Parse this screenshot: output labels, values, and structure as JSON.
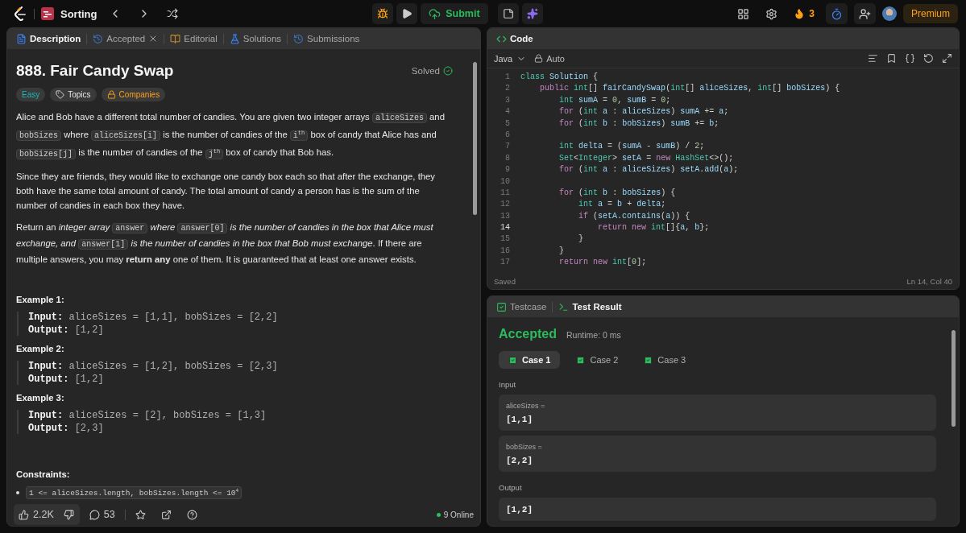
{
  "top_bar": {
    "problem_list": "Sorting",
    "submit": "Submit",
    "streak": "3",
    "premium": "Premium"
  },
  "description": {
    "tabs": [
      {
        "label": "Description",
        "selected": true,
        "closable": false,
        "kind": "description"
      },
      {
        "label": "Accepted",
        "selected": false,
        "closable": true,
        "kind": "history"
      },
      {
        "label": "Editorial",
        "selected": false,
        "closable": false,
        "kind": "book"
      },
      {
        "label": "Solutions",
        "selected": false,
        "closable": false,
        "kind": "flask"
      },
      {
        "label": "Submissions",
        "selected": false,
        "closable": false,
        "kind": "history"
      }
    ],
    "title": "888. Fair Candy Swap",
    "status": "Solved",
    "tags": [
      {
        "label": "Easy",
        "kind": "difficulty"
      },
      {
        "label": "Topics",
        "kind": "topics"
      },
      {
        "label": "Companies",
        "kind": "companies"
      }
    ],
    "paragraphs": [
      [
        {
          "kind": "text",
          "text": "Alice and Bob have a different total number of candies. You are given two integer arrays "
        },
        {
          "kind": "code",
          "text": "aliceSizes"
        },
        {
          "kind": "text",
          "text": " and "
        },
        {
          "kind": "code",
          "text": "bobSizes"
        },
        {
          "kind": "text",
          "text": " where "
        },
        {
          "kind": "code",
          "text": "aliceSizes[i]"
        },
        {
          "kind": "text",
          "text": " is the number of candies of the "
        },
        {
          "kind": "code",
          "text": "i$^{th}$"
        },
        {
          "kind": "text",
          "text": " box of candy that Alice has and "
        },
        {
          "kind": "code",
          "text": "bobSizes[j]"
        },
        {
          "kind": "text",
          "text": " is the number of candies of the "
        },
        {
          "kind": "code",
          "text": "j$^{th}$"
        },
        {
          "kind": "text",
          "text": " box of candy that Bob has."
        }
      ],
      [
        {
          "kind": "text",
          "text": "Since they are friends, they would like to exchange one candy box each so that after the exchange, they both have the same total amount of candy. The total amount of candy a person has is the sum of the number of candies in each box they have."
        }
      ],
      [
        {
          "kind": "text",
          "text": "Return an *integer array* "
        },
        {
          "kind": "code",
          "text": "answer"
        },
        {
          "kind": "text",
          "text": " *where* "
        },
        {
          "kind": "code",
          "text": "answer[0]"
        },
        {
          "kind": "text",
          "text": " *is the number of candies in the box that Alice must exchange, and* "
        },
        {
          "kind": "code",
          "text": "answer[1]"
        },
        {
          "kind": "text",
          "text": " *is the number of candies in the box that Bob must exchange*. If there are multiple answers, you may **return any** one of them. It is guaranteed that at least one answer exists."
        }
      ]
    ],
    "examples": [
      {
        "title": "Example 1:",
        "input_label": "Input:",
        "input": "aliceSizes = [1,1], bobSizes = [2,2]",
        "output_label": "Output:",
        "output": "[1,2]"
      },
      {
        "title": "Example 2:",
        "input_label": "Input:",
        "input": "aliceSizes = [1,2], bobSizes = [2,3]",
        "output_label": "Output:",
        "output": "[1,2]"
      },
      {
        "title": "Example 3:",
        "input_label": "Input:",
        "input": "aliceSizes = [2], bobSizes = [1,3]",
        "output_label": "Output:",
        "output": "[2,3]"
      }
    ],
    "constraints_title": "Constraints:",
    "constraints": [
      "1 <= aliceSizes.length, bobSizes.length <= 10$^{4}$"
    ],
    "footer": {
      "likes": "2.2K",
      "comments": "53",
      "online": "9 Online"
    }
  },
  "code": {
    "title": "Code",
    "language": "Java",
    "mode": "Auto",
    "lines": [
      {
        "number": "1",
        "code": "class Solution {",
        "current": false
      },
      {
        "number": "2",
        "code": "    public int[] fairCandySwap(int[] aliceSizes, int[] bobSizes) {",
        "current": false
      },
      {
        "number": "3",
        "code": "        int sumA = 0, sumB = 0;",
        "current": false
      },
      {
        "number": "4",
        "code": "        for (int a : aliceSizes) sumA += a;",
        "current": false
      },
      {
        "number": "5",
        "code": "        for (int b : bobSizes) sumB += b;",
        "current": false
      },
      {
        "number": "6",
        "current": false
      },
      {
        "number": "7",
        "code": "        int delta = (sumA - sumB) / 2;",
        "current": false
      },
      {
        "number": "8",
        "code": "        Set<Integer> setA = new HashSet<>();",
        "current": false
      },
      {
        "number": "9",
        "code": "        for (int a : aliceSizes) setA.add(a);",
        "current": false
      },
      {
        "number": "10",
        "current": false
      },
      {
        "number": "11",
        "code": "        for (int b : bobSizes) {",
        "current": false
      },
      {
        "number": "12",
        "code": "            int a = b + delta;",
        "current": false
      },
      {
        "number": "13",
        "code": "            if (setA.contains(a)) {",
        "current": false
      },
      {
        "number": "14",
        "code": "                return new int[]{a, b};",
        "current": true
      },
      {
        "number": "15",
        "code": "            }",
        "current": false
      },
      {
        "number": "16",
        "code": "        }",
        "current": false
      },
      {
        "number": "17",
        "code": "        return new int[0];",
        "current": false
      }
    ],
    "status": "Saved",
    "cursor": "Ln 14, Col 40"
  },
  "result": {
    "tabs": [
      {
        "label": "Testcase",
        "selected": false,
        "kind": "testcase"
      },
      {
        "label": "Test Result",
        "selected": true,
        "kind": "terminal"
      }
    ],
    "verdict": "Accepted",
    "runtime": "Runtime: 0 ms",
    "cases": [
      {
        "label": "Case 1",
        "selected": true,
        "passed": true
      },
      {
        "label": "Case 2",
        "selected": false,
        "passed": true
      },
      {
        "label": "Case 3",
        "selected": false,
        "passed": true
      }
    ],
    "input_label": "Input",
    "inputs": [
      {
        "name": "aliceSizes =",
        "value": "[1,1]"
      },
      {
        "name": "bobSizes =",
        "value": "[2,2]"
      }
    ],
    "output_label": "Output",
    "output": "[1,2]"
  }
}
